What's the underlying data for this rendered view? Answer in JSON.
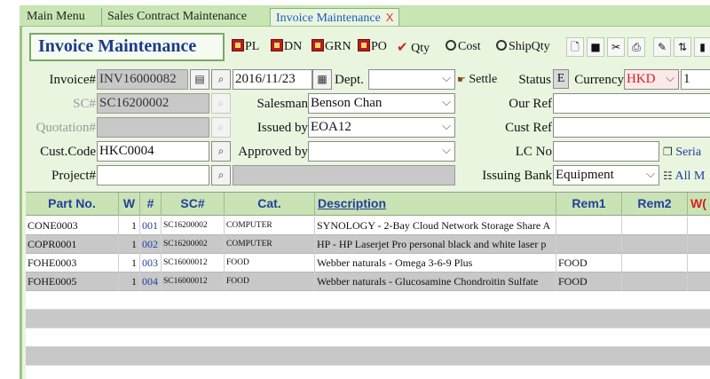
{
  "tabs": [
    {
      "label": "Main Menu"
    },
    {
      "label": "Sales Contract Maintenance"
    },
    {
      "label": "Invoice Maintenance",
      "close": "X"
    }
  ],
  "title": "Invoice Maintenance",
  "toolbar": {
    "pl": "PL",
    "dn": "DN",
    "grn": "GRN",
    "po": "PO",
    "qty": "Qty",
    "cost": "Cost",
    "shipqty": "ShipQty"
  },
  "form": {
    "invoice_label": "Invoice#",
    "invoice_value": "INV16000082",
    "date_value": "2016/11/23",
    "dept_label": "Dept.",
    "dept_value": "",
    "settle_label": "Settle",
    "status_label": "Status",
    "status_value": "E",
    "currency_label": "Currency",
    "currency_value": "HKD",
    "rate_value": "1",
    "sc_label": "SC#",
    "sc_value": "SC16200002",
    "salesman_label": "Salesman",
    "salesman_value": "Benson Chan",
    "ourref_label": "Our Ref",
    "ourref_value": "",
    "quotation_label": "Quotation#",
    "quotation_value": "",
    "issuedby_label": "Issued by",
    "issuedby_value": "EOA12",
    "custref_label": "Cust Ref",
    "custref_value": "",
    "custcode_label": "Cust.Code",
    "custcode_value": "HKC0004",
    "approvedby_label": "Approved by",
    "approvedby_value": "",
    "lcno_label": "LC No",
    "lcno_value": "",
    "serial_label": "Seria",
    "project_label": "Project#",
    "project_value": "",
    "project_desc": "",
    "issuingbank_label": "Issuing Bank",
    "issuingbank_value": "Equipment",
    "allm_label": "All M"
  },
  "grid": {
    "headers": {
      "part": "Part No.",
      "w": "W",
      "no": "#",
      "sc": "SC#",
      "cat": "Cat.",
      "desc": "Description",
      "rem1": "Rem1",
      "rem2": "Rem2",
      "extra": "W("
    },
    "rows": [
      {
        "part": "CONE0003",
        "w": "1",
        "no": "001",
        "sc": "SC16200002",
        "cat": "COMPUTER",
        "desc": "SYNOLOGY - 2-Bay Cloud Network Storage Share A",
        "rem1": "",
        "rem2": ""
      },
      {
        "part": "COPR0001",
        "w": "1",
        "no": "002",
        "sc": "SC16200002",
        "cat": "COMPUTER",
        "desc": "HP - HP Laserjet Pro personal black and white laser p",
        "rem1": "",
        "rem2": ""
      },
      {
        "part": "FOHE0003",
        "w": "1",
        "no": "003",
        "sc": "SC16000012",
        "cat": "FOOD",
        "desc": "Webber naturals - Omega 3-6-9 Plus",
        "rem1": "FOOD",
        "rem2": ""
      },
      {
        "part": "FOHE0005",
        "w": "1",
        "no": "004",
        "sc": "SC16000012",
        "cat": "FOOD",
        "desc": "Webber naturals - Glucosamine Chondroitin Sulfate",
        "rem1": "FOOD",
        "rem2": ""
      }
    ]
  },
  "colors": {
    "accent": "#1b3b8a",
    "header_bg": "#c9e3b5",
    "panel_bg": "#eaf5df",
    "currency_text": "#d42020"
  }
}
